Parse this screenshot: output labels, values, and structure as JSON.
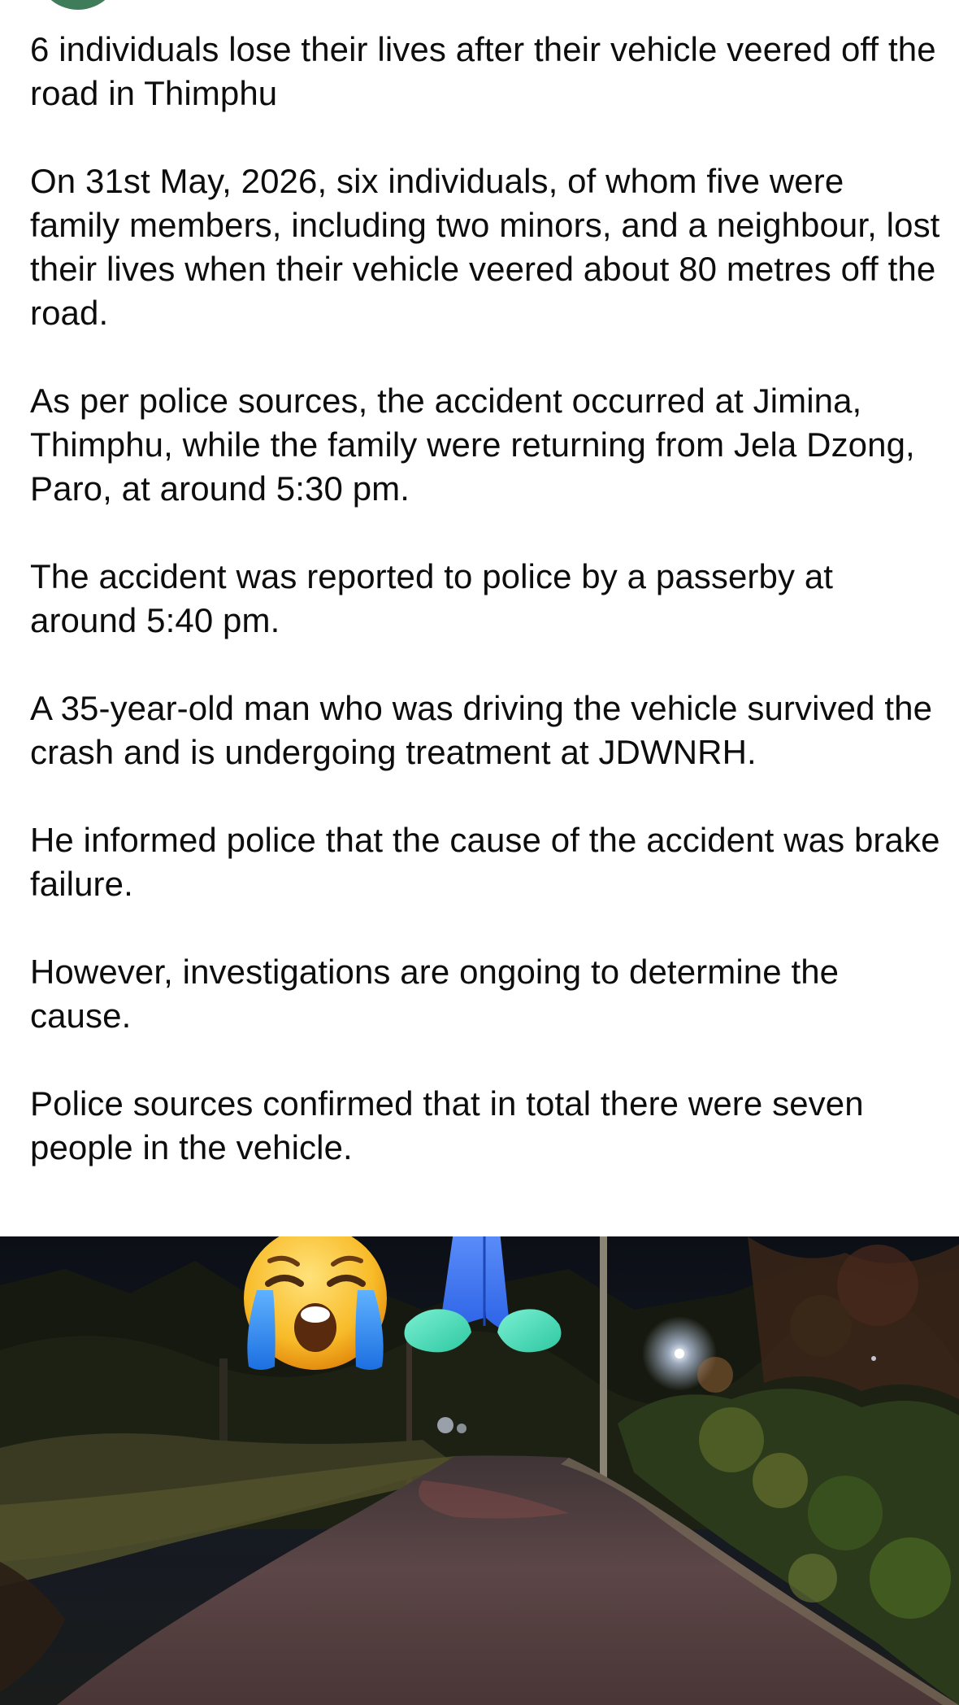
{
  "post": {
    "paragraphs": [
      "6 individuals lose their lives after their vehicle veered off the road in Thimphu",
      "On 31st May, 2026, six individuals, of whom five were family members, including two minors, and a neighbour, lost their lives when their vehicle veered about 80 metres off the road.",
      "As per police sources, the accident occurred at Jimina, Thimphu, while the family were returning from Jela Dzong, Paro, at around 5:30 pm.",
      "The accident was reported to police by a passerby at around 5:40 pm.",
      "A 35-year-old man who was driving the vehicle survived the crash and is undergoing treatment at JDWNRH.",
      "He informed police that the cause of the accident was brake failure.",
      "However, investigations are ongoing to determine the cause.",
      "Police sources confirmed that in total there were seven people in the vehicle."
    ],
    "reactions": [
      {
        "emoji": "loudly-crying-face-icon",
        "color": "#f7b52a"
      },
      {
        "emoji": "folded-hands-icon",
        "color": "#3d7df0"
      }
    ]
  },
  "photo": {
    "scene": "night-road-photo",
    "palette": {
      "sky": "#10141c",
      "road": "#5a4444",
      "foliage": "#2a3320",
      "light": "#dfe9ff"
    }
  }
}
